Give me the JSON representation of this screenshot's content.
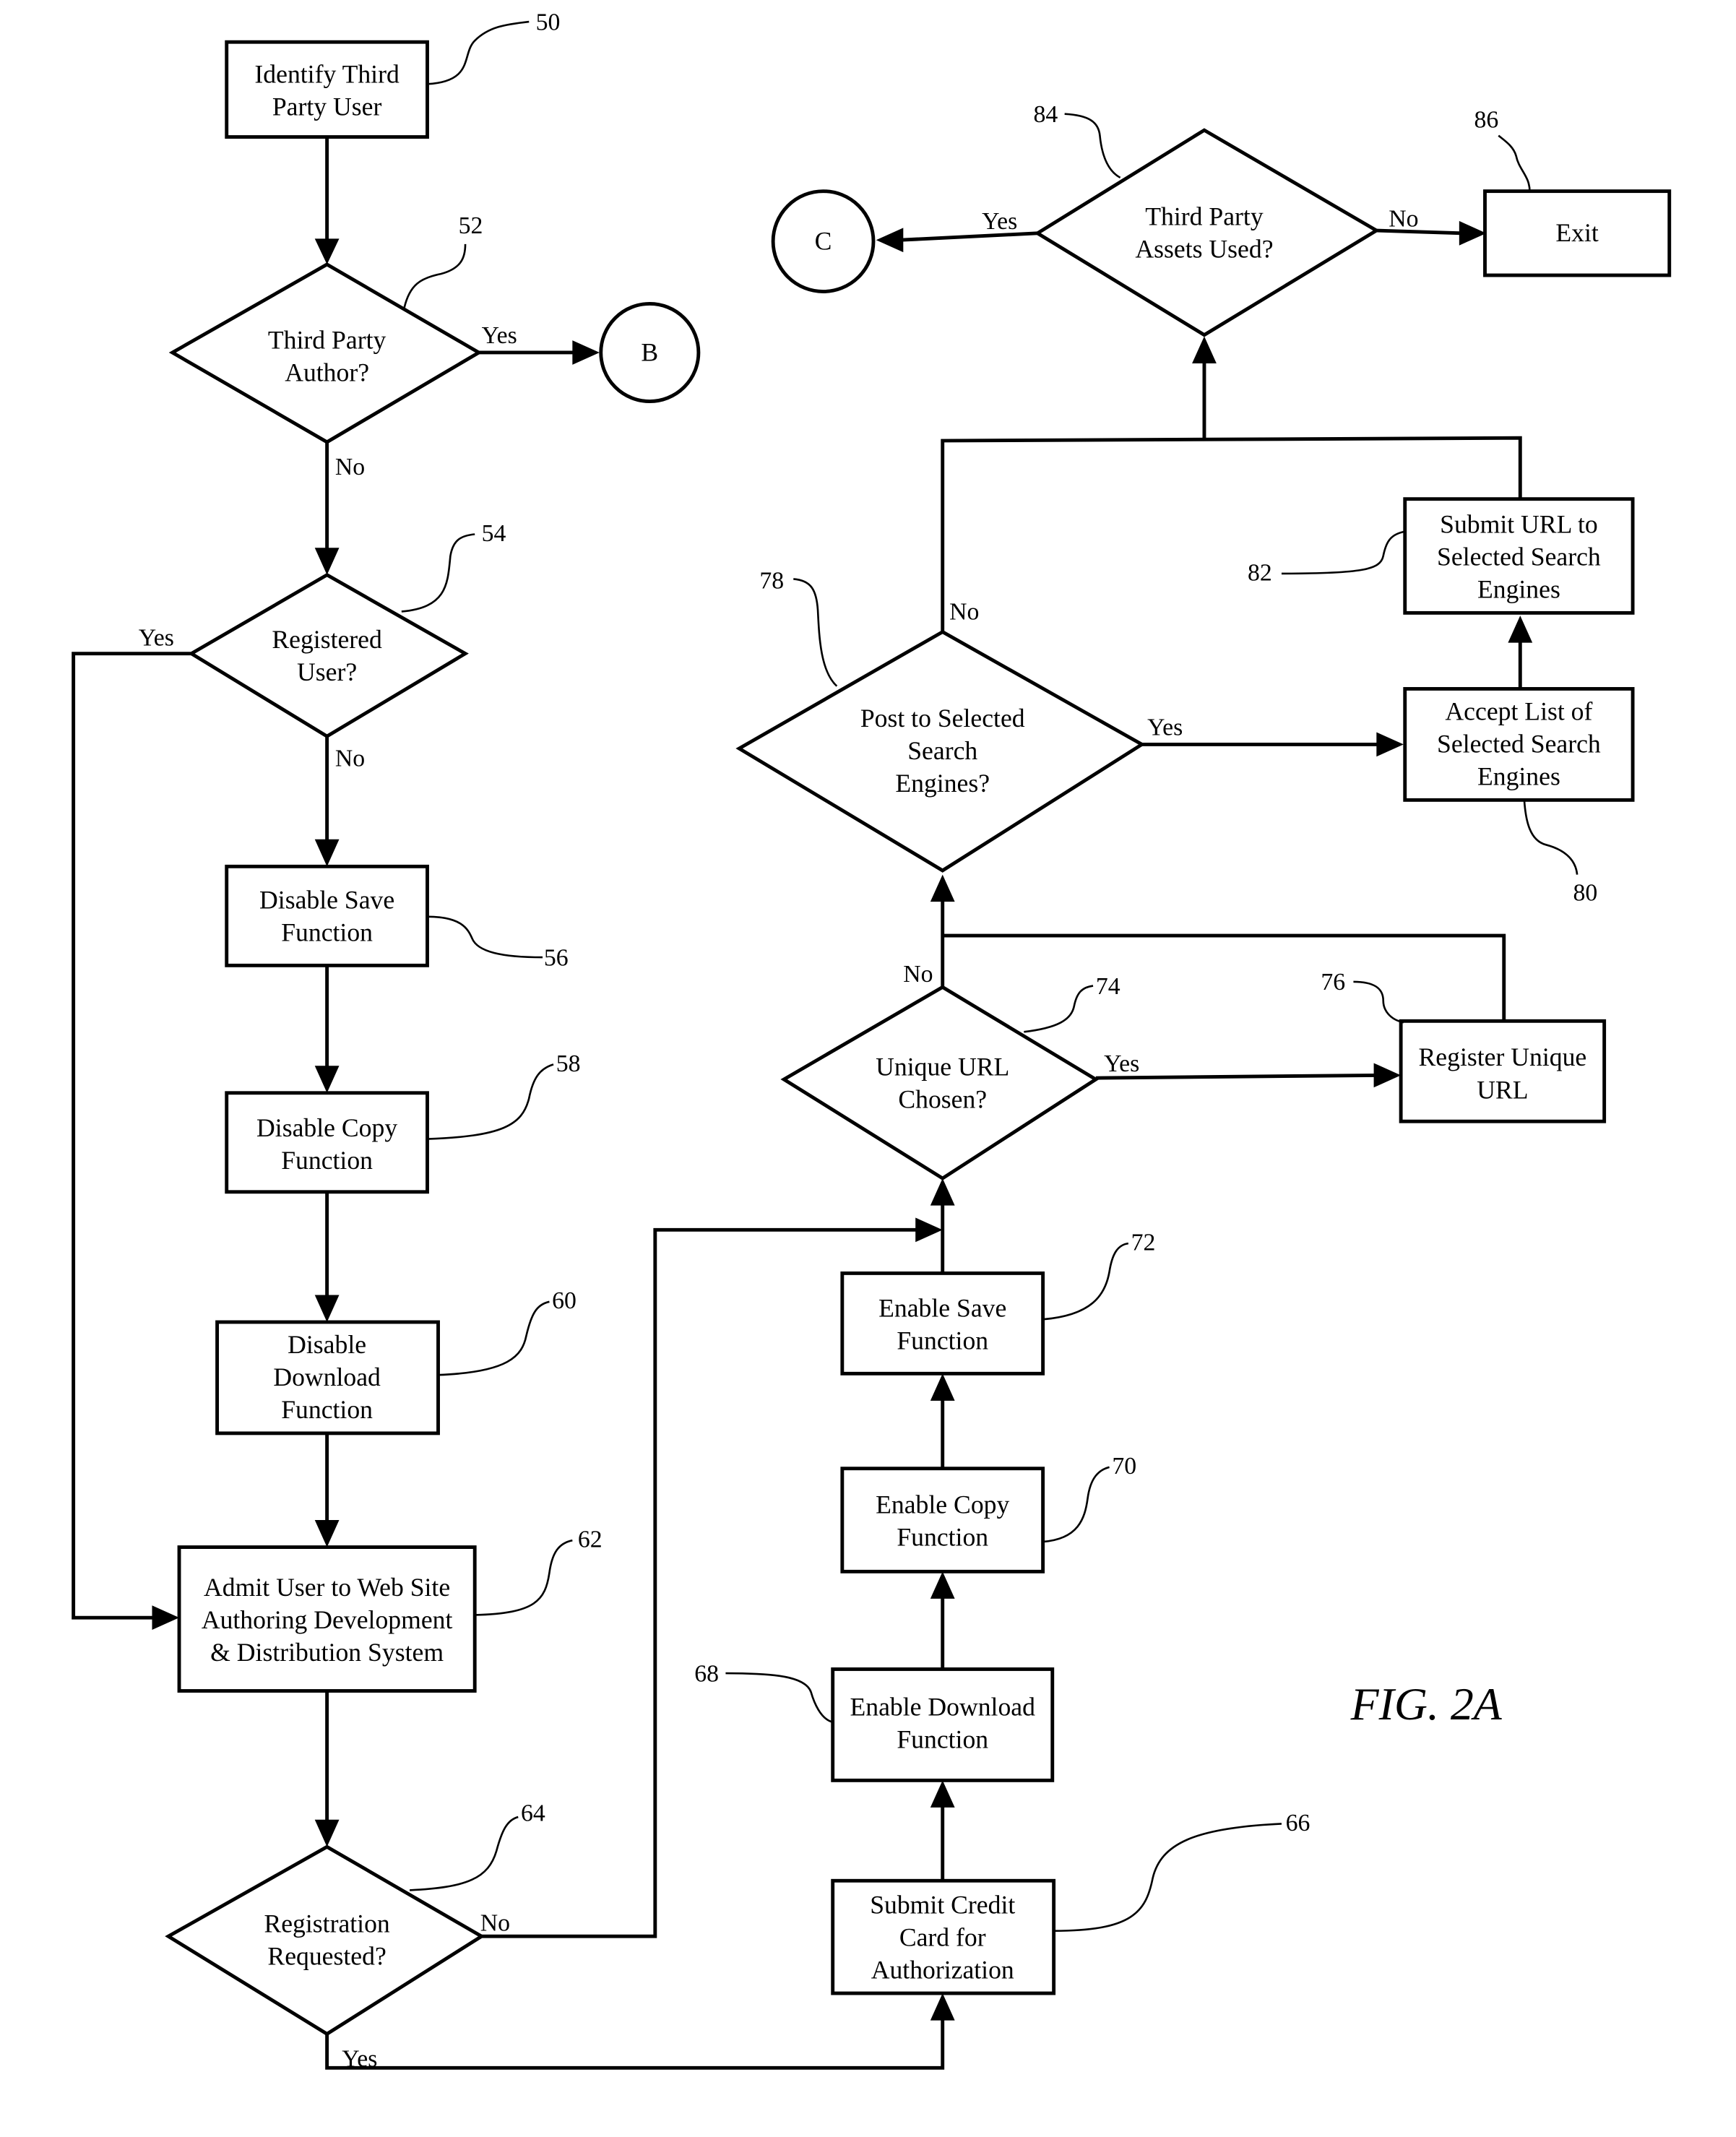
{
  "figure_label": "FIG. 2A",
  "nodes": {
    "n50": {
      "ref": "50",
      "lines": [
        "Identify Third",
        "Party User"
      ]
    },
    "n52": {
      "ref": "52",
      "lines": [
        "Third Party",
        "Author?"
      ]
    },
    "n54": {
      "ref": "54",
      "lines": [
        "Registered",
        "User?"
      ]
    },
    "n56": {
      "ref": "56",
      "lines": [
        "Disable Save",
        "Function"
      ]
    },
    "n58": {
      "ref": "58",
      "lines": [
        "Disable Copy",
        "Function"
      ]
    },
    "n60": {
      "ref": "60",
      "lines": [
        "Disable",
        "Download",
        "Function"
      ]
    },
    "n62": {
      "ref": "62",
      "lines": [
        "Admit User to Web Site",
        "Authoring Development",
        "& Distribution System"
      ]
    },
    "n64": {
      "ref": "64",
      "lines": [
        "Registration",
        "Requested?"
      ]
    },
    "n66": {
      "ref": "66",
      "lines": [
        "Submit Credit",
        "Card for",
        "Authorization"
      ]
    },
    "n68": {
      "ref": "68",
      "lines": [
        "Enable Download",
        "Function"
      ]
    },
    "n70": {
      "ref": "70",
      "lines": [
        "Enable Copy",
        "Function"
      ]
    },
    "n72": {
      "ref": "72",
      "lines": [
        "Enable Save",
        "Function"
      ]
    },
    "n74": {
      "ref": "74",
      "lines": [
        "Unique URL",
        "Chosen?"
      ]
    },
    "n76": {
      "ref": "76",
      "lines": [
        "Register Unique",
        "URL"
      ]
    },
    "n78": {
      "ref": "78",
      "lines": [
        "Post to Selected",
        "Search",
        "Engines?"
      ]
    },
    "n80": {
      "ref": "80",
      "lines": [
        "Accept List of",
        "Selected Search",
        "Engines"
      ]
    },
    "n82": {
      "ref": "82",
      "lines": [
        "Submit URL to",
        "Selected Search",
        "Engines"
      ]
    },
    "n84": {
      "ref": "84",
      "lines": [
        "Third Party",
        "Assets Used?"
      ]
    },
    "n86": {
      "ref": "86",
      "lines": [
        "Exit"
      ]
    }
  },
  "connectors": {
    "B": "B",
    "C": "C"
  },
  "edge_labels": {
    "n52_yes": "Yes",
    "n52_no": "No",
    "n54_yes": "Yes",
    "n54_no": "No",
    "n64_yes": "Yes",
    "n64_no": "No",
    "n74_yes": "Yes",
    "n74_no": "No",
    "n78_yes": "Yes",
    "n78_no": "No",
    "n84_yes": "Yes",
    "n84_no": "No"
  }
}
